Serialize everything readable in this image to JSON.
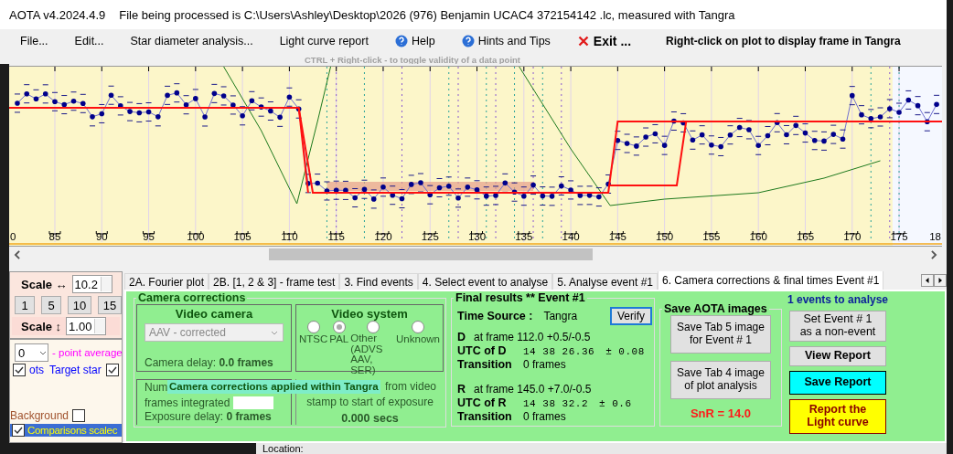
{
  "window": {
    "title": "AOTA v4.2024.4.9",
    "file_info": "File being processed is C:\\Users\\Ashley\\Desktop\\2026 (976) Benjamin UCAC4 372154142 .lc, measured with Tangra"
  },
  "menu": [
    {
      "label": "File...",
      "kind": "plain"
    },
    {
      "label": "Edit...",
      "kind": "plain"
    },
    {
      "label": "Star diameter analysis...",
      "kind": "plain"
    },
    {
      "label": "Light curve report",
      "kind": "plain"
    },
    {
      "label": "Help",
      "kind": "help"
    },
    {
      "label": "Hints and Tips",
      "kind": "help"
    },
    {
      "label": "Exit ...",
      "kind": "exit"
    }
  ],
  "plot_hint": "Right-click on plot to display frame in Tangra",
  "ctrl_hint": "CTRL + Right-click  -  to toggle validity of a data point",
  "plot": {
    "x_labels": [
      "0",
      "85",
      "90",
      "95",
      "100",
      "105",
      "110",
      "115",
      "120",
      "125",
      "130",
      "135",
      "140",
      "145",
      "150",
      "155",
      "160",
      "165",
      "170",
      "175",
      "18"
    ]
  },
  "left_panel": {
    "h_scale": {
      "label": "Scale ↔",
      "value": "10.2"
    },
    "scale_buttons": [
      "1",
      "5",
      "10",
      "15"
    ],
    "v_scale": {
      "label": "Scale ↕",
      "value": "1.00"
    },
    "average": {
      "value": "0",
      "label": "- point average"
    },
    "options": [
      {
        "label": "ots",
        "checked": true,
        "kind": "left",
        "selected": false
      },
      {
        "label": "Target star",
        "checked": true,
        "kind": "right",
        "selected": false
      },
      {
        "label": "Background",
        "checked": false,
        "kind": "right",
        "selected": false
      },
      {
        "label": "Comparisons scalec",
        "checked": true,
        "kind": "left",
        "selected": true
      }
    ]
  },
  "tabs": [
    {
      "label": "2A. Fourier plot",
      "selected": false
    },
    {
      "label": "2B. [1, 2 & 3] - frame test",
      "selected": false
    },
    {
      "label": "3. Find events",
      "selected": false
    },
    {
      "label": "4. Select event to analyse",
      "selected": false
    },
    {
      "label": "5. Analyse event #1",
      "selected": false
    },
    {
      "label": "6. Camera corrections & final times Event #1",
      "selected": true
    }
  ],
  "camera": {
    "title": "Camera corrections",
    "video_camera": {
      "title": "Video camera",
      "value": "AAV - corrected",
      "disabled": true,
      "delay": "Camera delay: **0.0 frames**"
    },
    "video_system": {
      "title": "Video system",
      "options": [
        {
          "label": "NTSC",
          "selected": false
        },
        {
          "label": "PAL",
          "selected": true
        },
        {
          "label": "Other (ADVS AAV, SER)",
          "selected": false
        },
        {
          "label": "Unknown",
          "selected": false
        }
      ]
    },
    "integration": {
      "line1": "Num",
      "line2": "frames integrated",
      "exposure": "Exposure delay: **0 frames**"
    },
    "offset": {
      "line1": "from video",
      "line2": "stamp to start of exposure",
      "value": "0.000 secs"
    },
    "tooltip": "Camera corrections applied within Tangra"
  },
  "final_results": {
    "title": "Final results  **  Event #1",
    "time_source_label": "Time Source :",
    "time_source": "Tangra",
    "verify": "Verify",
    "events": [
      {
        "letter": "D",
        "frame": "at frame 112.0  +0.5/-0.5",
        "utc_label": "UTC of D",
        "utc": "14 38 26.36",
        "error": "± 0.08",
        "transition_label": "Transition",
        "transition": "0 frames"
      },
      {
        "letter": "R",
        "frame": "at frame 145.0  +7.0/-0.5",
        "utc_label": "UTC of R",
        "utc": "14 38 32.2",
        "error": "± 0.6",
        "transition_label": "Transition",
        "transition": "0 frames"
      }
    ]
  },
  "save_images": {
    "title": "Save AOTA images",
    "buttons": [
      "Save Tab 5 image\nfor Event # 1",
      "Save Tab 4 image\nof plot analysis"
    ],
    "snr": "SnR = 14.0"
  },
  "events_count": "1 events to analyse",
  "actions": [
    {
      "label": "Set Event # 1\nas a non-event",
      "kind": "plain"
    },
    {
      "label": "View Report",
      "kind": "bold"
    },
    {
      "label": "Save Report",
      "kind": "save"
    },
    {
      "label": "Report the\nLight curve",
      "kind": "report"
    }
  ],
  "background": {
    "location_label": "Location:"
  }
}
